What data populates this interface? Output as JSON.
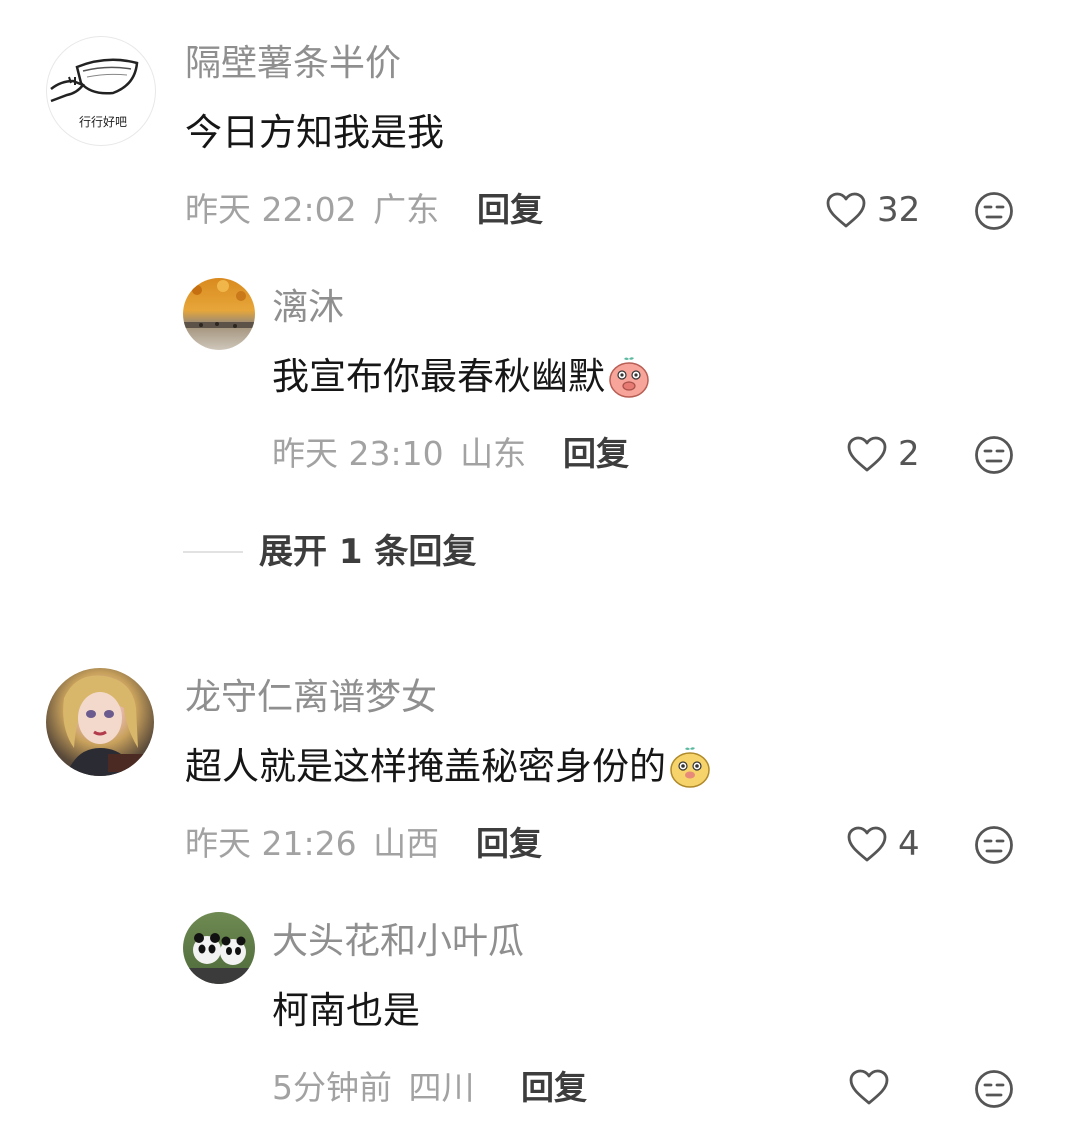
{
  "comments": [
    {
      "username": "隔壁薯条半价",
      "avatar_text": "行行好吧",
      "text": "今日方知我是我",
      "time": "昨天 22:02",
      "location": "广东",
      "reply_label": "回复",
      "likes": "32"
    },
    {
      "username": "漓沐",
      "text": "我宣布你最春秋幽默",
      "time": "昨天 23:10",
      "location": "山东",
      "reply_label": "回复",
      "likes": "2"
    },
    {
      "username": "龙守仁离谱梦女",
      "text": "超人就是这样掩盖秘密身份的",
      "time": "昨天 21:26",
      "location": "山西",
      "reply_label": "回复",
      "likes": "4"
    },
    {
      "username": "大头花和小叶瓜",
      "text": "柯南也是",
      "time": "5分钟前",
      "location": "四川",
      "reply_label": "回复",
      "likes": ""
    }
  ],
  "expand_replies_label": "展开 1 条回复",
  "colors": {
    "username": "#8f8f8f",
    "text": "#161616",
    "meta": "#a2a2a2",
    "icon": "#555555"
  },
  "icons": [
    "heart-icon",
    "dislike-face-icon",
    "pig-emoji",
    "bear-emoji"
  ]
}
